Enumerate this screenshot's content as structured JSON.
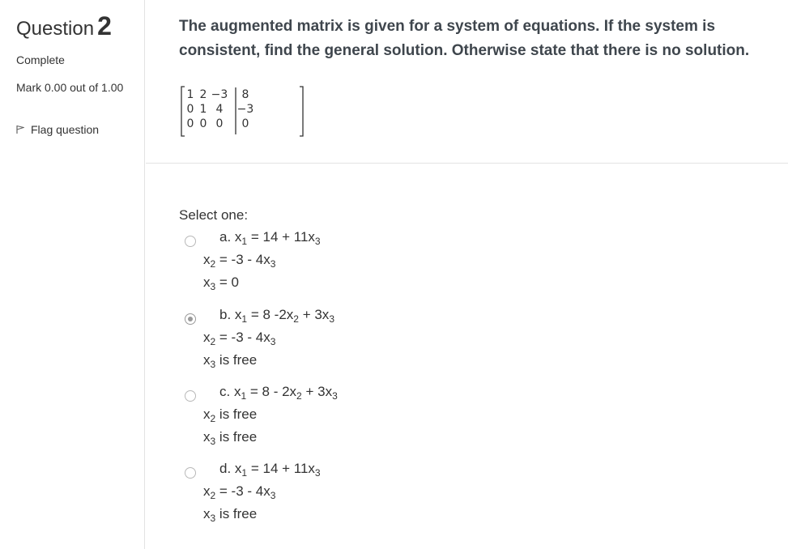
{
  "info": {
    "question_word": "Question",
    "question_number": "2",
    "state": "Complete",
    "mark": "Mark 0.00 out of 1.00",
    "flag_label": "Flag question"
  },
  "question": {
    "text": "The augmented matrix is given for a system of equations. If the system is consistent, find the general solution. Otherwise state that there is no solution.",
    "matrix": {
      "rows": [
        [
          "1",
          "2",
          "−3",
          "8"
        ],
        [
          "0",
          "1",
          "4",
          "−3"
        ],
        [
          "0",
          "0",
          "0",
          "0"
        ]
      ]
    }
  },
  "answer": {
    "prompt": "Select one:",
    "options": [
      {
        "label": "a.",
        "line1_pre": "x",
        "line1_sub": "1",
        "line1_rest": " = 14 + 11x",
        "line1_sub2": "3",
        "line1_tail": "",
        "line2_pre": "x",
        "line2_sub": "2",
        "line2_rest": " = -3 - 4x",
        "line2_sub2": "3",
        "line3_pre": "x",
        "line3_sub": "3",
        "line3_rest": " = 0",
        "selected": false
      },
      {
        "label": "b.",
        "line1_pre": "x",
        "line1_sub": "1",
        "line1_rest": " = 8 -2x",
        "line1_sub2": "2",
        "line1_tail": " + 3x",
        "line1_sub3": "3",
        "line2_pre": "x",
        "line2_sub": "2",
        "line2_rest": " = -3 - 4x",
        "line2_sub2": "3",
        "line3_pre": "x",
        "line3_sub": "3",
        "line3_rest": " is free",
        "selected": true
      },
      {
        "label": "c.",
        "line1_pre": "x",
        "line1_sub": "1",
        "line1_rest": " = 8 - 2x",
        "line1_sub2": "2",
        "line1_tail": " + 3x",
        "line1_sub3": "3",
        "line2_pre": "x",
        "line2_sub": "2",
        "line2_rest": " is free",
        "line2_sub2": "",
        "line3_pre": "x",
        "line3_sub": "3",
        "line3_rest": " is free",
        "selected": false
      },
      {
        "label": "d.",
        "line1_pre": "x",
        "line1_sub": "1",
        "line1_rest": " = 14 + 11x",
        "line1_sub2": "3",
        "line1_tail": "",
        "line2_pre": "x",
        "line2_sub": "2",
        "line2_rest": " = -3 - 4x",
        "line2_sub2": "3",
        "line3_pre": "x",
        "line3_sub": "3",
        "line3_rest": " is free",
        "selected": false
      }
    ]
  },
  "colors": {
    "border": "#e3e3e3",
    "text": "#333333",
    "question_text": "#3f464d",
    "radio_checked": "#9a9a9a"
  }
}
